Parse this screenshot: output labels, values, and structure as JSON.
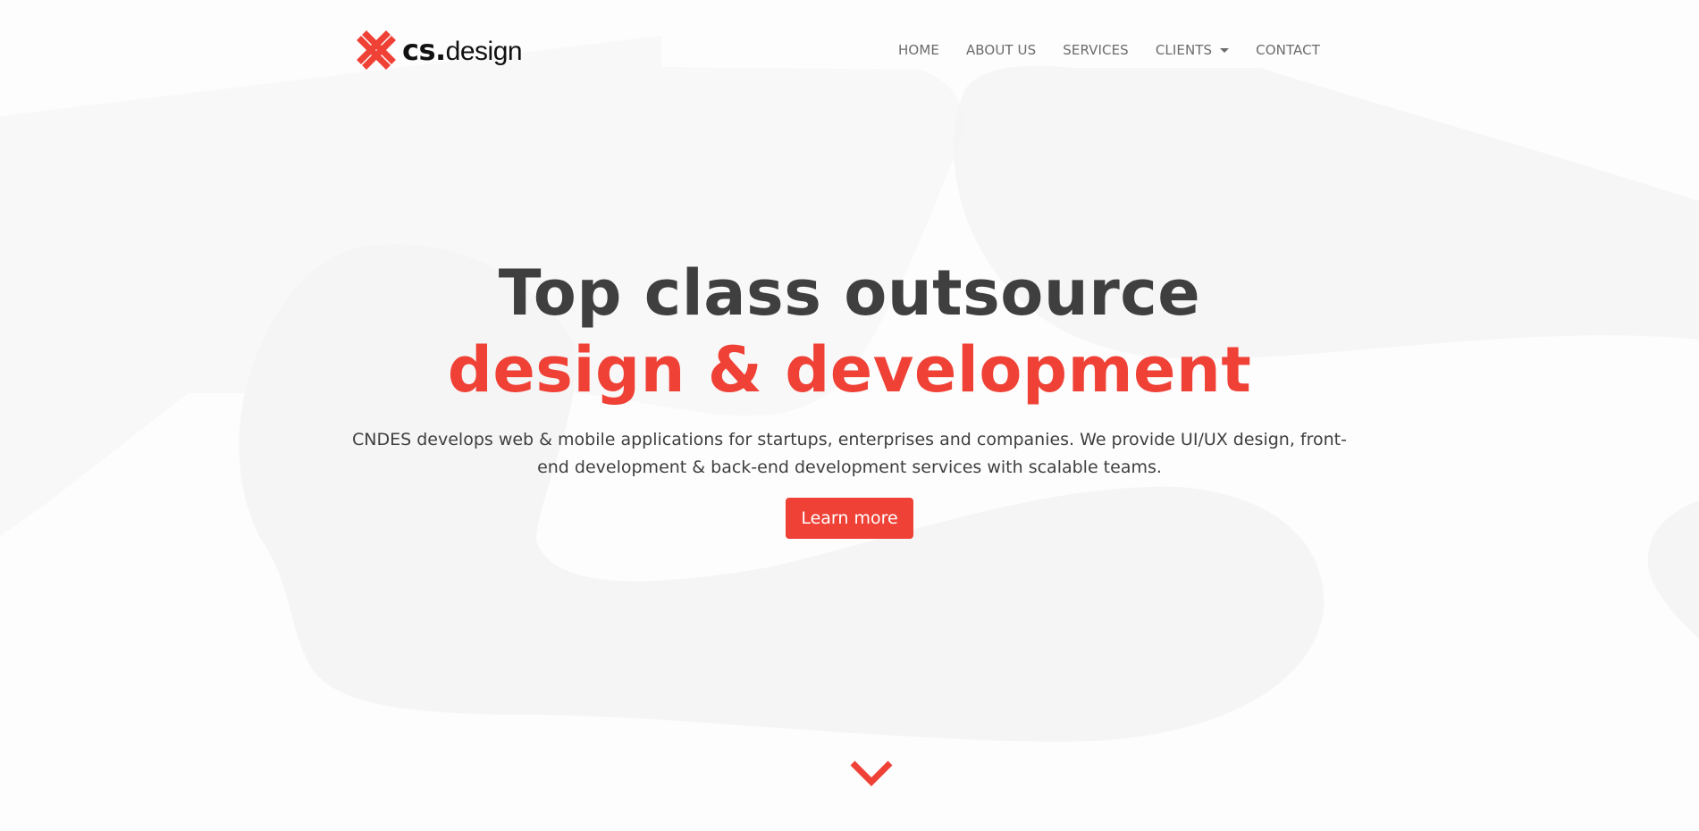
{
  "brand": {
    "name_bold": "cs.",
    "name_light": "design",
    "icon": "cross-logo-icon",
    "accent_color": "#ef4136"
  },
  "nav": {
    "items": [
      {
        "label": "HOME"
      },
      {
        "label": "ABOUT US"
      },
      {
        "label": "SERVICES"
      },
      {
        "label": "CLIENTS",
        "has_dropdown": true
      },
      {
        "label": "CONTACT"
      }
    ]
  },
  "hero": {
    "title_line1": "Top class outsource",
    "title_line2": "design & development",
    "title_color": "#3f3f3f",
    "highlight_color": "#ef4136",
    "description": "CNDES develops web & mobile applications for startups, enterprises and companies. We provide UI/UX design, front-end development & back-end development services with scalable teams.",
    "cta_label": "Learn more"
  },
  "scroll": {
    "icon": "chevron-down-icon"
  }
}
